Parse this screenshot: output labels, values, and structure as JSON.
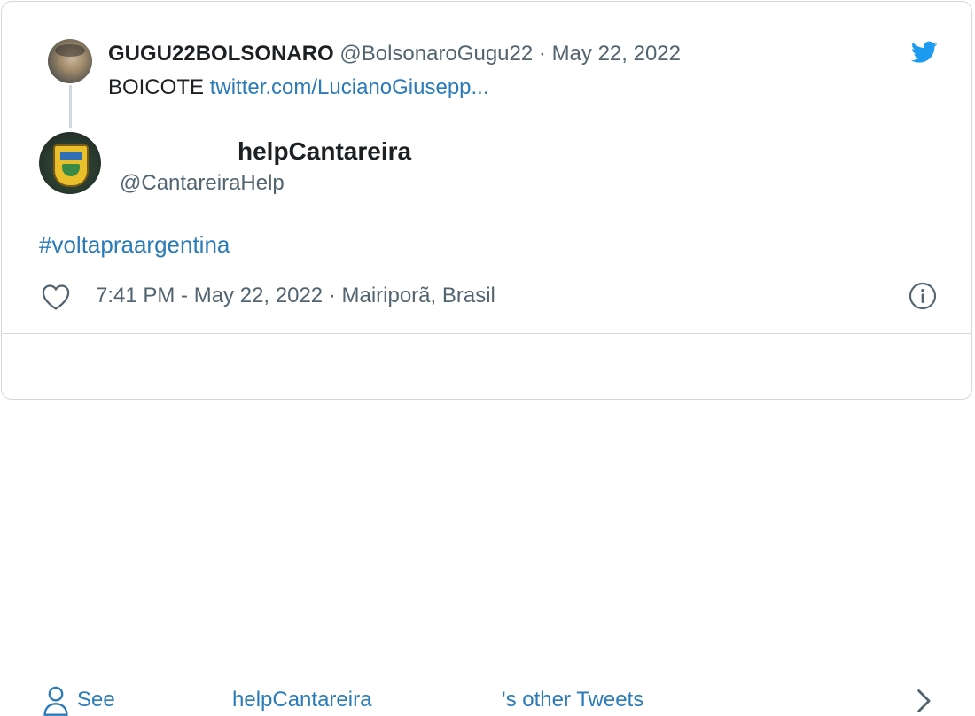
{
  "quoted_tweet": {
    "display_name": "GUGU22BOLSONARO",
    "handle": "@BolsonaroGugu22",
    "separator": "·",
    "date": "May 22, 2022",
    "text": "BOICOTE",
    "link_text": "twitter.com/LucianoGiusepp..."
  },
  "tweet": {
    "display_name": "helpCantareira",
    "handle": "@CantareiraHelp",
    "hashtag": "#voltapraargentina",
    "timestamp": "7:41 PM - May 22, 2022",
    "separator": "·",
    "location": "Mairiporã, Brasil"
  },
  "footer": {
    "see_label": "See",
    "name": "helpCantareira",
    "suffix": "'s other Tweets"
  },
  "colors": {
    "link": "#2b7bb9",
    "secondary_text": "#536471",
    "twitter_blue": "#1d9bf0",
    "border": "#cfd9de"
  },
  "icons": [
    "twitter-logo-icon",
    "heart-icon",
    "info-icon",
    "person-icon",
    "chevron-right-icon"
  ]
}
